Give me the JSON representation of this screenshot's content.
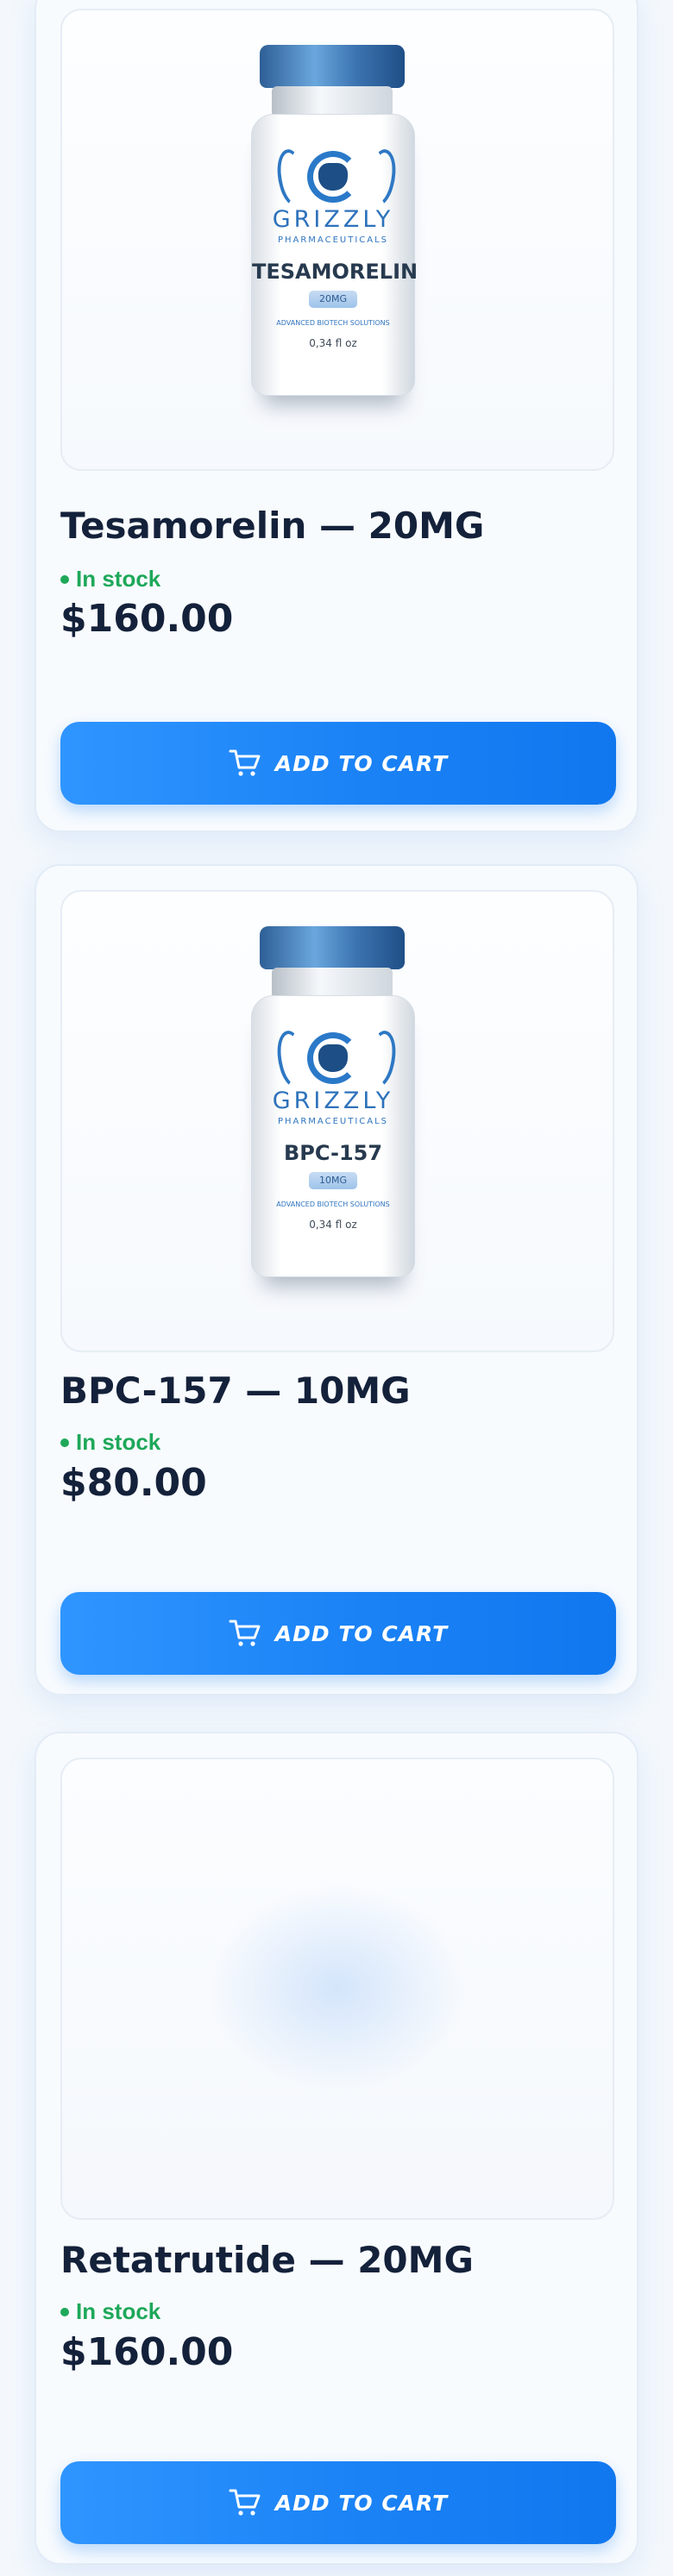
{
  "products": [
    {
      "title": "Tesamorelin — 20MG",
      "stock": "In stock",
      "price": "$160.00",
      "button_label": "ADD TO CART",
      "image": {
        "brand": "GRIZZLY",
        "subbrand": "PHARMACEUTICALS",
        "product_name": "TESAMORELIN",
        "dose": "20MG",
        "tagline": "ADVANCED BIOTECH SOLUTIONS",
        "volume": "0,34 fl oz"
      }
    },
    {
      "title": "BPC-157 — 10MG",
      "stock": "In stock",
      "price": "$80.00",
      "button_label": "ADD TO CART",
      "image": {
        "brand": "GRIZZLY",
        "subbrand": "PHARMACEUTICALS",
        "product_name": "BPC-157",
        "dose": "10MG",
        "tagline": "ADVANCED BIOTECH SOLUTIONS",
        "volume": "0,34 fl oz"
      }
    },
    {
      "title": "Retatrutide — 20MG",
      "stock": "In stock",
      "price": "$160.00",
      "button_label": "ADD TO CART",
      "image": null
    }
  ],
  "icons": {
    "cart": "shopping-cart-icon",
    "stock_indicator": "stock-dot-icon"
  },
  "colors": {
    "primary_button": "#1a82f5",
    "stock_green": "#1ea85a",
    "text_dark": "#14213a",
    "vial_blue": "#2d72bb"
  }
}
